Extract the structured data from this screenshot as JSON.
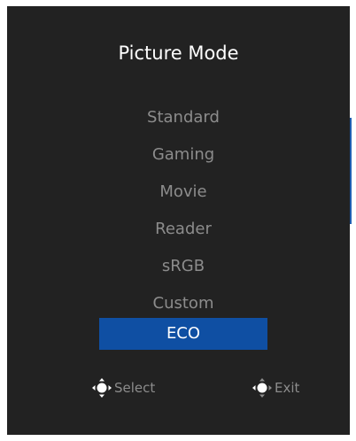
{
  "osd": {
    "title": "Picture Mode",
    "items": [
      {
        "label": "Standard",
        "selected": false
      },
      {
        "label": "Gaming",
        "selected": false
      },
      {
        "label": "Movie",
        "selected": false
      },
      {
        "label": "Reader",
        "selected": false
      },
      {
        "label": "sRGB",
        "selected": false
      },
      {
        "label": "Custom",
        "selected": false
      },
      {
        "label": "ECO",
        "selected": true
      }
    ],
    "hints": {
      "select_label": "Select",
      "exit_label": "Exit"
    }
  },
  "colors": {
    "panel_bg": "#222222",
    "selected_bg": "#0f4fa3",
    "text_dim": "#8c8c8c",
    "text_bright": "#ffffff"
  },
  "icons": {
    "select": "joystick-press-icon",
    "exit": "joystick-left-icon"
  }
}
